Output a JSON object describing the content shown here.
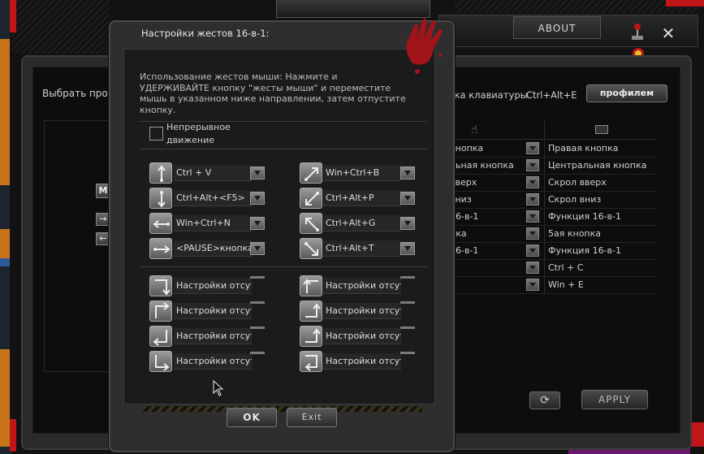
{
  "main": {
    "about_tab": "ABOUT",
    "select_profile_label": "Выбрать профил",
    "keyboard_shortcut_label": "пка клавиатуры",
    "keyboard_shortcut_value": "Ctrl+Alt+E",
    "profile_button": "профилем",
    "apply_button": "APPLY",
    "left_button_m": "M",
    "left_arrow_right": "→",
    "left_arrow_left": "←",
    "mapping_rows": [
      {
        "left": "кнопка",
        "right": "Правая кнопка"
      },
      {
        "left": "льная кнопка",
        "right": "Центральная кнопка"
      },
      {
        "left": "вверх",
        "right": "Скрол вверх"
      },
      {
        "left": "вниз",
        "right": "Скрол вниз"
      },
      {
        "left": "16-в-1",
        "right": "Функция 16-в-1"
      },
      {
        "left": "пка",
        "right": "5ая кнопка"
      },
      {
        "left": "16-в-1",
        "right": "Функция 16-в-1"
      },
      {
        "left": "",
        "right": "Ctrl + C"
      },
      {
        "left": "",
        "right": "Win + E"
      }
    ]
  },
  "dialog": {
    "title": "Настройки жестов 16-в-1:",
    "instructions": "Использование жестов мыши: Нажмите и УДЕРЖИВАЙТЕ кнопку \"жесты мыши\" и переместите мышь в указанном ниже направлении, затем отпустите кнопку.",
    "continuous_label": "Непрерывное движение",
    "gestures_left": [
      {
        "icon": "arrow-up-down-icon",
        "value": "Ctrl + V"
      },
      {
        "icon": "arrow-down-up-icon",
        "value": "Ctrl+Alt+<F5>"
      },
      {
        "icon": "arrow-left-icon",
        "value": "Win+Ctrl+N"
      },
      {
        "icon": "arrow-right-icon",
        "value": "<PAUSE>кнопка"
      },
      {
        "icon": "corner-up-right-down-icon",
        "value": "Настройки отсутствуют"
      },
      {
        "icon": "corner-up-right-icon",
        "value": "Настройки отсутствуют"
      },
      {
        "icon": "corner-down-left-icon",
        "value": "Настройки отсутствуют"
      },
      {
        "icon": "corner-down-right-icon",
        "value": "Настройки отсутствуют"
      }
    ],
    "gestures_right": [
      {
        "icon": "arrow-diagonal-up-right-icon",
        "value": "Win+Ctrl+B"
      },
      {
        "icon": "arrow-diagonal-down-left-icon",
        "value": "Ctrl+Alt+P"
      },
      {
        "icon": "arrow-diagonal-up-left-icon",
        "value": "Ctrl+Alt+G"
      },
      {
        "icon": "arrow-diagonal-down-right-icon",
        "value": "Ctrl+Alt+T"
      },
      {
        "icon": "corner-up-left-right-icon",
        "value": "Настройки отсутствуют"
      },
      {
        "icon": "corner-down-up-left-icon",
        "value": "Настройки отсутствуют"
      },
      {
        "icon": "corner-up-right-left-icon",
        "value": "Настройки отсутствуют"
      },
      {
        "icon": "corner-down-left-right-icon",
        "value": "Настройки отсутствуют"
      }
    ],
    "ok_button": "OK",
    "exit_button": "Exit"
  },
  "colors": {
    "accent_red": "#c0161a",
    "background": "#1b1b1b"
  }
}
